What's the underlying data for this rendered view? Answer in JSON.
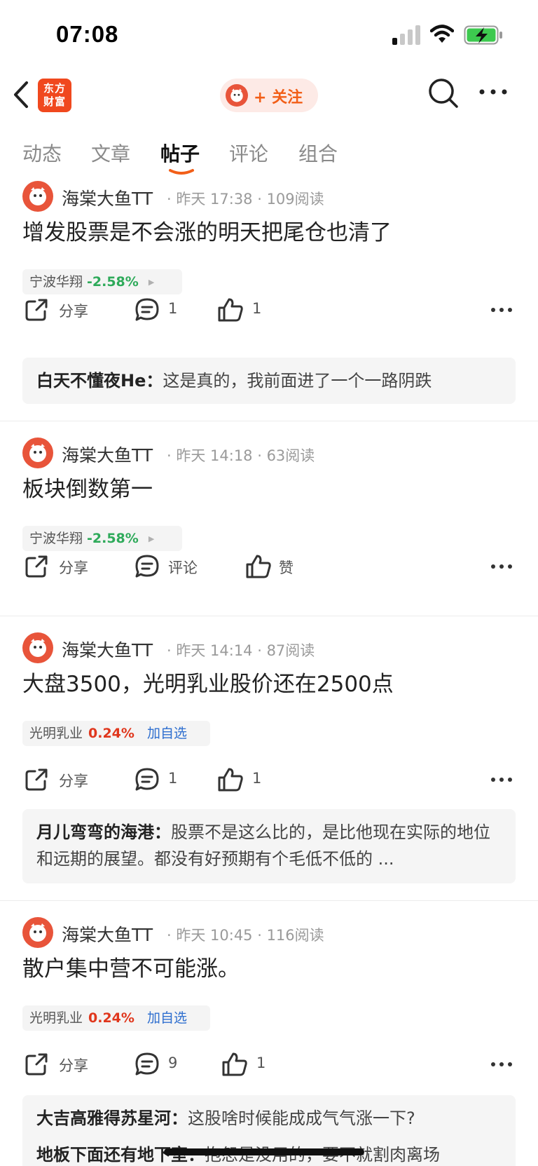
{
  "status_bar": {
    "time": "07:08"
  },
  "nav": {
    "logo_line1": "东方",
    "logo_line2": "财富",
    "follow_label": "+ 关注",
    "colors": {
      "brand": "#f0481e",
      "follow_text": "#f25f18"
    }
  },
  "tabs": [
    {
      "label": "动态",
      "active": false
    },
    {
      "label": "文章",
      "active": false
    },
    {
      "label": "帖子",
      "active": true
    },
    {
      "label": "评论",
      "active": false
    },
    {
      "label": "组合",
      "active": false
    }
  ],
  "posts": [
    {
      "author": "海棠大鱼TT",
      "meta": "· 昨天 17:38 · 109阅读",
      "content": "增发股票是不会涨的明天把尾仓也清了",
      "stock": {
        "name": "宁波华翔",
        "pct": "-2.58%",
        "direction": "down"
      },
      "share_label": "分享",
      "comment_count": "1",
      "like_count": "1",
      "replies": [
        {
          "who": "白天不懂夜He",
          "text": "这是真的，我前面进了一个一路阴跌"
        }
      ]
    },
    {
      "author": "海棠大鱼TT",
      "meta": "· 昨天 14:18 · 63阅读",
      "content": "板块倒数第一",
      "stock": {
        "name": "宁波华翔",
        "pct": "-2.58%",
        "direction": "down"
      },
      "share_label": "分享",
      "comment_label": "评论",
      "like_label": "赞"
    },
    {
      "author": "海棠大鱼TT",
      "meta": "· 昨天 14:14 · 87阅读",
      "content": "大盘3500，光明乳业股价还在2500点",
      "stock": {
        "name": "光明乳业",
        "pct": "0.24%",
        "direction": "up",
        "add_watch": "加自选"
      },
      "share_label": "分享",
      "comment_count": "1",
      "like_count": "1",
      "replies": [
        {
          "who": "月儿弯弯的海港",
          "text": "股票不是这么比的，是比他现在实际的地位和远期的展望。都没有好预期有个毛低不低的 ..."
        }
      ]
    },
    {
      "author": "海棠大鱼TT",
      "meta": "· 昨天 10:45 · 116阅读",
      "content": "散户集中营不可能涨。",
      "stock": {
        "name": "光明乳业",
        "pct": "0.24%",
        "direction": "up",
        "add_watch": "加自选"
      },
      "share_label": "分享",
      "comment_count": "9",
      "like_count": "1",
      "replies": [
        {
          "who": "大吉高雅得苏星河",
          "text": "这股啥时候能成成气气涨一下?"
        },
        {
          "who": "地板下面还有地下室",
          "text": "抱怨是没用的，要不就割肉离场"
        }
      ]
    }
  ]
}
